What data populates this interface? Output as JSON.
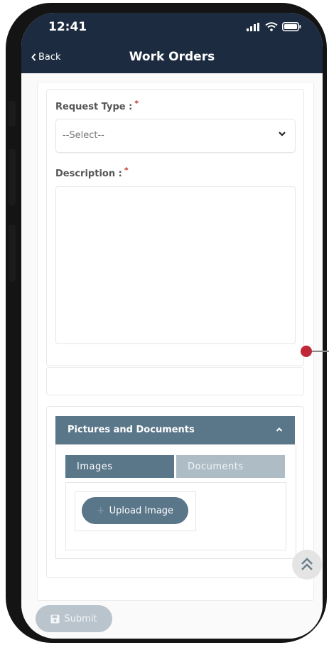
{
  "status_bar": {
    "time": "12:41"
  },
  "header": {
    "back_label": "Back",
    "title": "Work Orders"
  },
  "form": {
    "request_type_label": "Request Type :",
    "required_marker": "*",
    "request_type_placeholder": "--Select--",
    "description_label": "Description :",
    "description_value": ""
  },
  "pictures": {
    "title": "Pictures and Documents",
    "tabs": [
      {
        "label": "Images",
        "active": true
      },
      {
        "label": "Documents",
        "active": false
      }
    ],
    "upload_label": "Upload Image"
  },
  "footer": {
    "submit_label": "Submit"
  },
  "colors": {
    "header_bg": "#1c2b3f",
    "section_header": "#5a7689",
    "inactive_tab": "#aebcc6",
    "submit_disabled": "#b9c4cc",
    "required": "#c0392b",
    "annotation_dot": "#c0283a"
  }
}
